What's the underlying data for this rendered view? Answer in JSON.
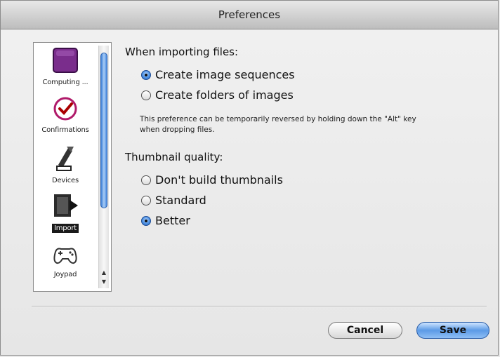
{
  "window": {
    "title": "Preferences"
  },
  "sidebar": {
    "items": [
      {
        "label": "Computing ...",
        "icon": "purple-square-icon",
        "selected": false
      },
      {
        "label": "Confirmations",
        "icon": "checkmark-icon",
        "selected": false
      },
      {
        "label": "Devices",
        "icon": "devices-icon",
        "selected": false
      },
      {
        "label": "Import",
        "icon": "import-icon",
        "selected": true
      },
      {
        "label": "Joypad",
        "icon": "joypad-icon",
        "selected": false
      }
    ],
    "scroll_up": "▲",
    "scroll_down": "▼"
  },
  "import": {
    "heading": "When importing files:",
    "options": [
      {
        "label": "Create image sequences",
        "selected": true
      },
      {
        "label": "Create folders of images",
        "selected": false
      }
    ],
    "note_line1": "This preference can be temporarily reversed by holding down the \"Alt\" key",
    "note_line2": "when dropping files."
  },
  "thumbnail": {
    "heading": "Thumbnail quality:",
    "options": [
      {
        "label": "Don't build thumbnails",
        "selected": false
      },
      {
        "label": "Standard",
        "selected": false
      },
      {
        "label": "Better",
        "selected": true
      }
    ]
  },
  "buttons": {
    "cancel": "Cancel",
    "save": "Save"
  },
  "colors": {
    "accent": "#4a8fe3",
    "icon_purple": "#7a2d8c"
  }
}
